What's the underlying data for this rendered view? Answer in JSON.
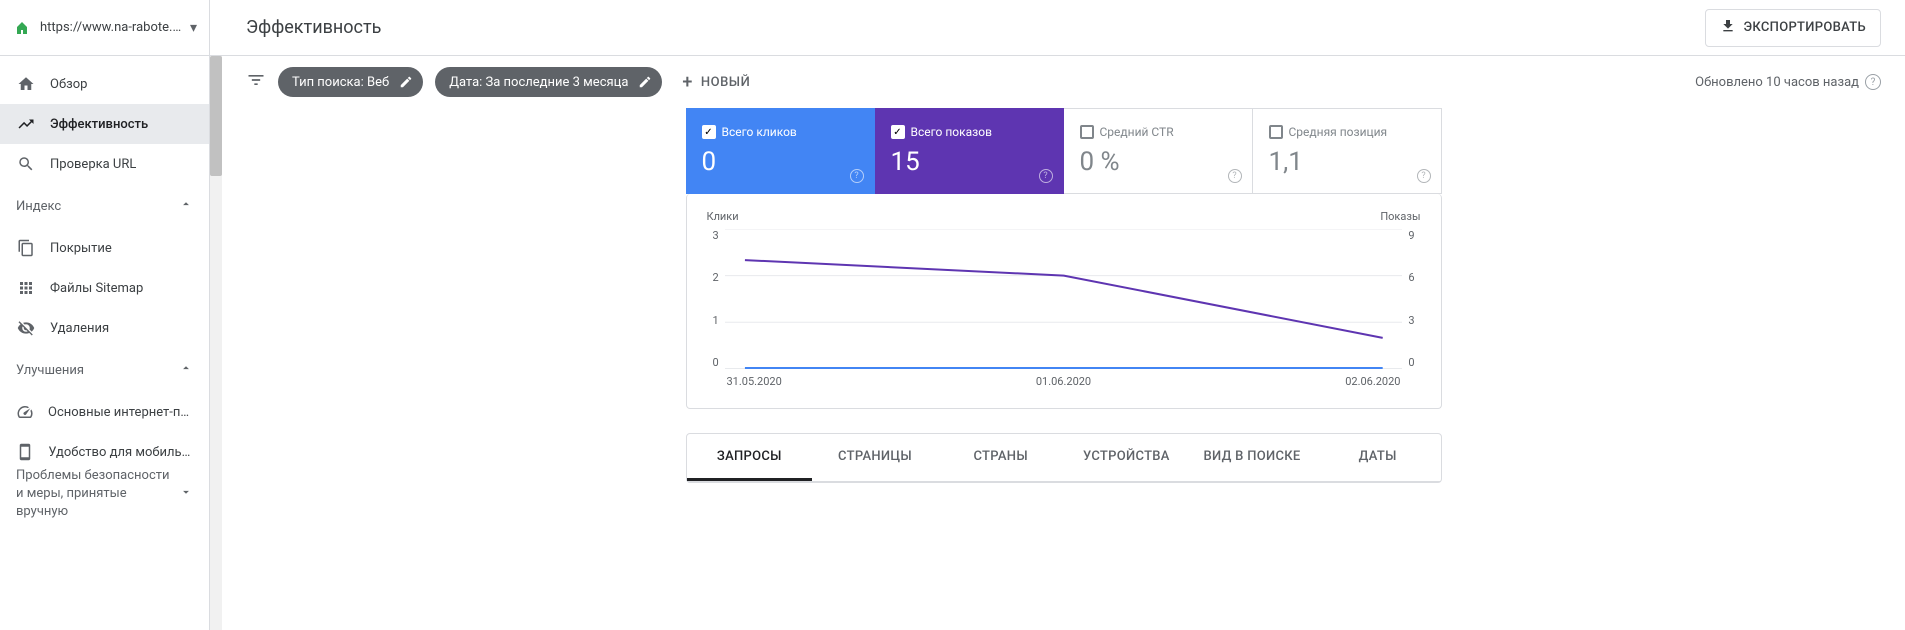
{
  "property": {
    "url": "https://www.na-rabote.by/"
  },
  "sidebar": {
    "items": [
      {
        "label": "Обзор"
      },
      {
        "label": "Эффективность"
      },
      {
        "label": "Проверка URL"
      }
    ],
    "section_index": "Индекс",
    "index_items": [
      {
        "label": "Покрытие"
      },
      {
        "label": "Файлы Sitemap"
      },
      {
        "label": "Удаления"
      }
    ],
    "section_enhance": "Улучшения",
    "enhance_items": [
      {
        "label": "Основные интернет-показ..."
      },
      {
        "label": "Удобство для мобильных"
      }
    ],
    "section_security": "Проблемы безопасности и меры, принятые вручную"
  },
  "header": {
    "title": "Эффективность",
    "export": "ЭКСПОРТИРОВАТЬ"
  },
  "filters": {
    "search_type": "Тип поиска: Веб",
    "date": "Дата: За последние 3 месяца",
    "new": "НОВЫЙ",
    "updated": "Обновлено 10 часов назад"
  },
  "metrics": [
    {
      "label": "Всего кликов",
      "value": "0"
    },
    {
      "label": "Всего показов",
      "value": "15"
    },
    {
      "label": "Средний CTR",
      "value": "0 %"
    },
    {
      "label": "Средняя позиция",
      "value": "1,1"
    }
  ],
  "chart": {
    "left_label": "Клики",
    "right_label": "Показы",
    "left_ticks": [
      "3",
      "2",
      "1",
      "0"
    ],
    "right_ticks": [
      "9",
      "6",
      "3",
      "0"
    ],
    "x_ticks": [
      "31.05.2020",
      "01.06.2020",
      "02.06.2020"
    ]
  },
  "chart_data": {
    "type": "line",
    "title": "",
    "xlabel": "",
    "ylabel_left": "Клики",
    "ylabel_right": "Показы",
    "x": [
      "31.05.2020",
      "01.06.2020",
      "02.06.2020"
    ],
    "series": [
      {
        "name": "Клики",
        "axis": "left",
        "values": [
          0,
          0,
          0
        ],
        "color": "#4285f4"
      },
      {
        "name": "Показы",
        "axis": "right",
        "values": [
          7,
          6,
          2
        ],
        "color": "#5e35b1"
      }
    ],
    "ylim_left": [
      0,
      3
    ],
    "ylim_right": [
      0,
      9
    ]
  },
  "tabs": [
    {
      "label": "ЗАПРОСЫ"
    },
    {
      "label": "СТРАНИЦЫ"
    },
    {
      "label": "СТРАНЫ"
    },
    {
      "label": "УСТРОЙСТВА"
    },
    {
      "label": "ВИД В ПОИСКЕ"
    },
    {
      "label": "ДАТЫ"
    }
  ]
}
